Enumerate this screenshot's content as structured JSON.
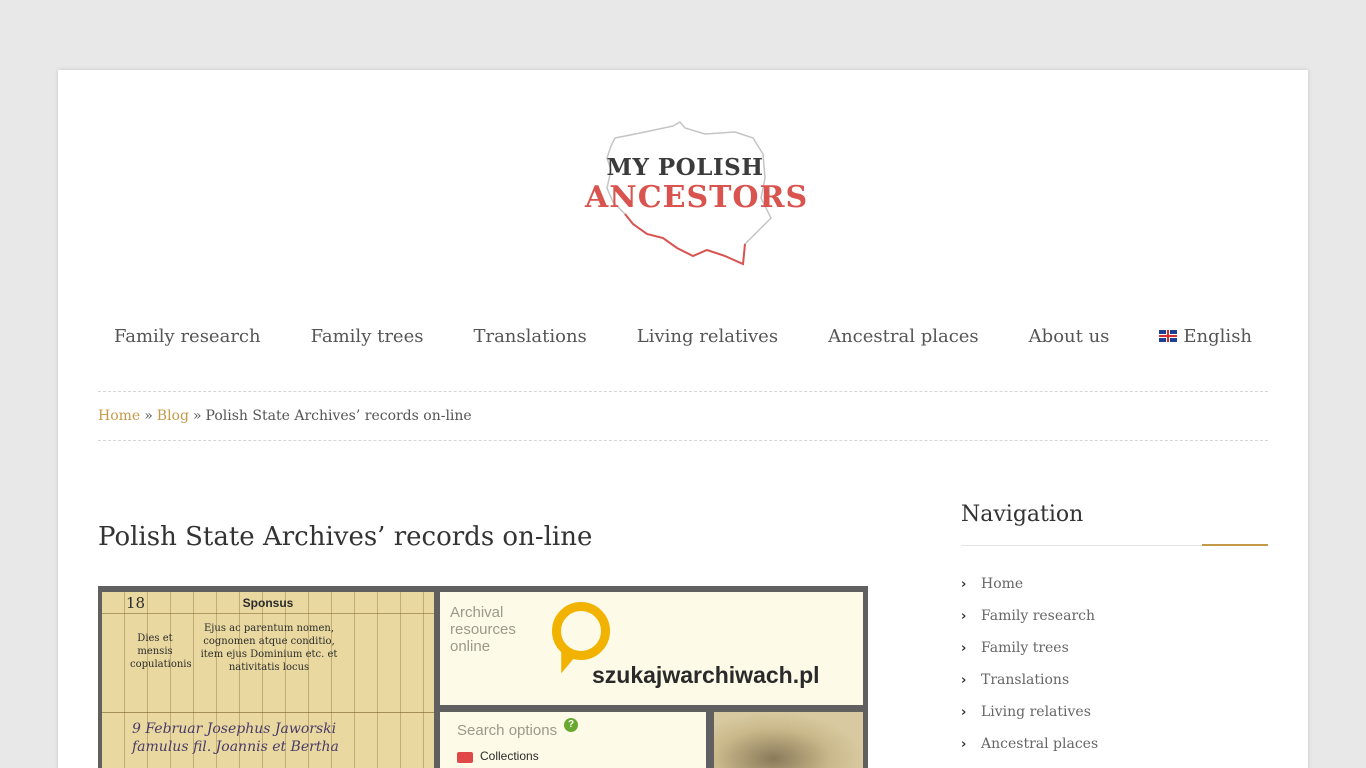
{
  "logo": {
    "line1": "MY POLISH",
    "line2": "ANCESTORS"
  },
  "nav": {
    "items": [
      {
        "label": "Family research"
      },
      {
        "label": "Family trees"
      },
      {
        "label": "Translations"
      },
      {
        "label": "Living relatives"
      },
      {
        "label": "Ancestral places"
      },
      {
        "label": "About us"
      }
    ],
    "language": {
      "label": "English",
      "icon": "uk-flag-icon"
    }
  },
  "breadcrumb": {
    "home": "Home",
    "sep": "»",
    "blog": "Blog",
    "current": "Polish State Archives’ records on-line"
  },
  "post": {
    "title": "Polish State Archives’ records on-line",
    "image": {
      "doc_number": "18",
      "doc_header": "Sponsus",
      "doc_ejus": "Ejus ac parentum nomen, cognomen atque conditio, item ejus Dominium etc. et nativitatis locus",
      "doc_dies": "Dies et mensis copulationis",
      "doc_hand": "9 Februar Josephus Jaworski famulus fil. Joannis et Bertha",
      "archival_text": "Archival resources online",
      "site_name": "szukajwarchiwach.pl",
      "search_options": "Search options",
      "help_glyph": "?",
      "collections": "Collections",
      "accent_color": "#f2b200"
    }
  },
  "sidebar": {
    "title": "Navigation",
    "items": [
      {
        "label": "Home"
      },
      {
        "label": "Family research"
      },
      {
        "label": "Family trees"
      },
      {
        "label": "Translations"
      },
      {
        "label": "Living relatives"
      },
      {
        "label": "Ancestral places"
      }
    ],
    "accent_color": "#c49a4a"
  }
}
